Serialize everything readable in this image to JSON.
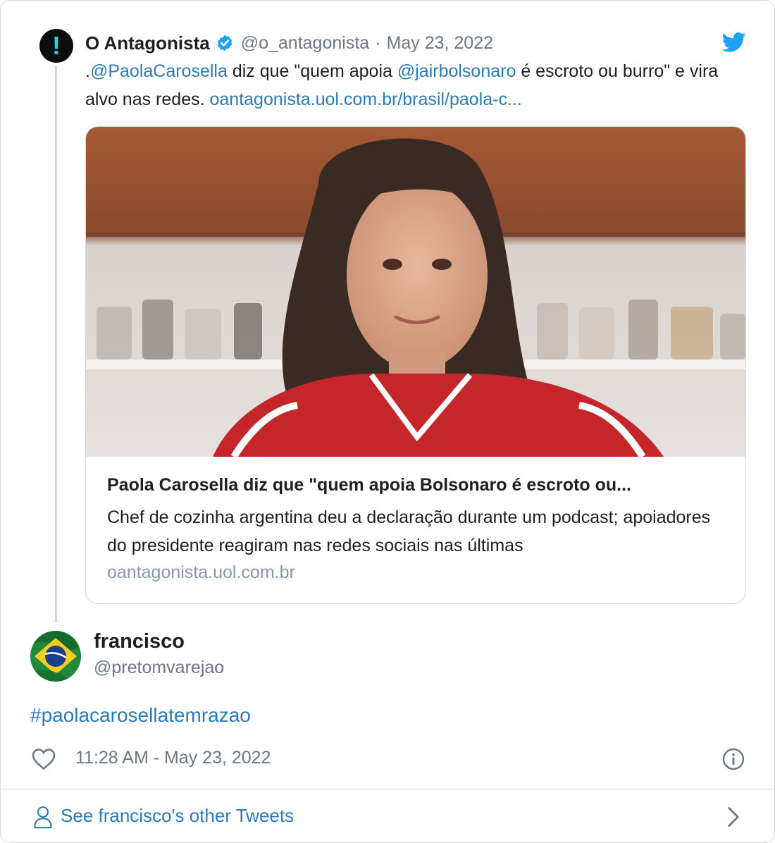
{
  "quoted_tweet": {
    "author_name": "O Antagonista",
    "author_handle": "@o_antagonista",
    "separator": "·",
    "date": "May 23, 2022",
    "text": {
      "prefix": ".",
      "mention1": "@PaolaCarosella",
      "part2": " diz que \"quem apoia ",
      "mention2": "@jairbolsonaro",
      "part3": " é escroto ou burro\" e vira alvo nas redes. ",
      "link": "oantagonista.uol.com.br/brasil/paola-c..."
    },
    "card": {
      "title": "Paola Carosella diz que \"quem apoia Bolsonaro é escroto ou...",
      "description": "Chef de cozinha argentina deu a declaração durante um podcast; apoiadores do presidente reagiram nas redes sociais nas últimas",
      "domain": "oantagonista.uol.com.br"
    },
    "avatar_icon": "exclamation-icon",
    "avatar_glyph": "!"
  },
  "tweet": {
    "author_name": "francisco",
    "author_handle": "@pretomvarejao",
    "text": "#paolacarosellatemrazao",
    "timestamp": "11:28 AM - May 23, 2022",
    "avatar_icon": "brazil-flag-avatar"
  },
  "footer": {
    "label": "See francisco's other Tweets"
  },
  "icons": [
    "verified-badge-icon",
    "twitter-bird-icon",
    "heart-icon",
    "info-icon",
    "person-icon",
    "chevron-right-icon"
  ],
  "colors": {
    "link": "#2b7bb9",
    "twitter_blue": "#1da1f2",
    "text": "#1c2022",
    "muted": "#697882",
    "border": "#cfd9de"
  }
}
